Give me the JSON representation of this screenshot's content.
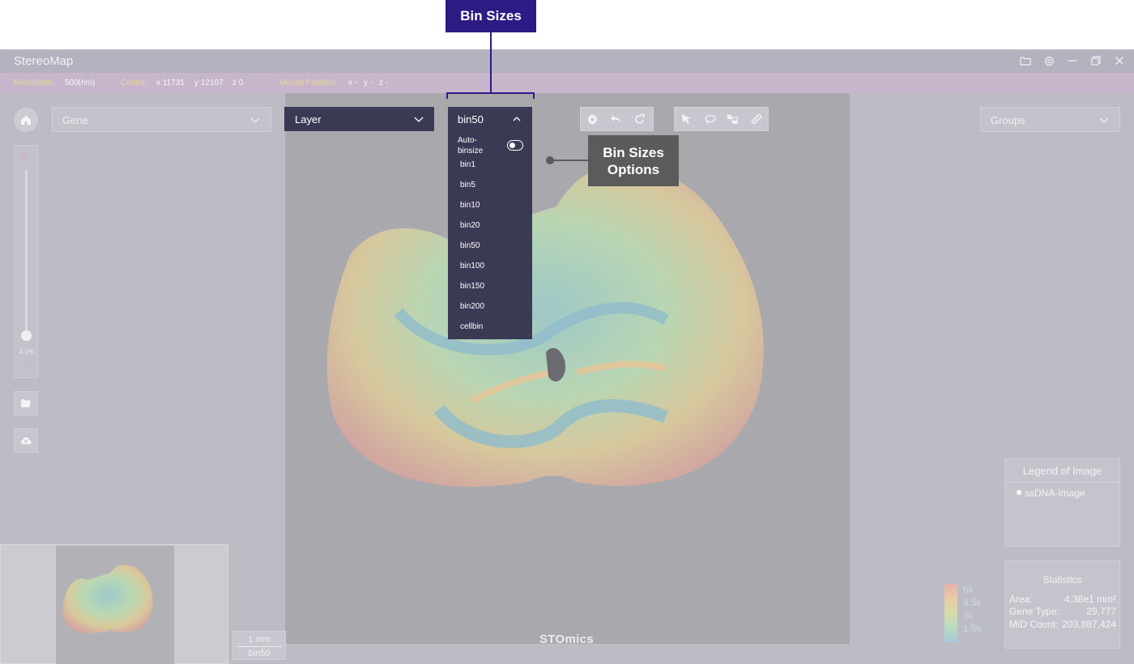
{
  "annotations": {
    "top_label": "Bin Sizes",
    "callout_label_line1": "Bin Sizes",
    "callout_label_line2": "Options",
    "accent_color": "#2d1a85",
    "callout_color": "#5b5b5b"
  },
  "app": {
    "title": "StereoMap",
    "window_controls": [
      "folder-icon",
      "gear-icon",
      "minimize-icon",
      "restore-icon",
      "close-icon"
    ]
  },
  "infobar": {
    "resolution_label": "Resolution:",
    "resolution_value": "500(nm)",
    "center_label": "Center:",
    "center_x": "x 11731",
    "center_y": "y 12107",
    "center_z": "z 0",
    "mouse_label": "Mouse Position:",
    "mouse_x": "x -",
    "mouse_y": "y -",
    "mouse_z": "z -"
  },
  "controls": {
    "gene_select": "Gene",
    "layer_select": "Layer",
    "groups_select": "Groups",
    "zoom_percent": "4.1%",
    "zoom_level_fraction": 0.041
  },
  "bin_dropdown": {
    "selected": "bin50",
    "auto_binsize_label": "Auto-binsize",
    "auto_binsize_on": false,
    "options": [
      "bin1",
      "bin5",
      "bin10",
      "bin20",
      "bin50",
      "bin100",
      "bin150",
      "bin200",
      "cellbin"
    ]
  },
  "toolbar_left": [
    "gear-icon",
    "undo-icon",
    "redo-icon"
  ],
  "toolbar_right": [
    "pointer-icon",
    "lasso-icon",
    "rect-select-icon",
    "ruler-icon"
  ],
  "legend": {
    "title": "Legend of Image",
    "items": [
      "ssDNA-Image"
    ]
  },
  "statistics": {
    "title": "Statistics",
    "rows": [
      {
        "key": "Area:",
        "value": "4.38e1 mm²"
      },
      {
        "key": "Gene Type:",
        "value": "29,777"
      },
      {
        "key": "MID Count:",
        "value": "203,887,424"
      }
    ]
  },
  "color_scale": {
    "ticks": [
      "6k",
      "4.5k",
      "3k",
      "1.5k"
    ]
  },
  "scale_box": {
    "length": "1 mm",
    "bin": "bin50"
  },
  "brand": "STOmics"
}
